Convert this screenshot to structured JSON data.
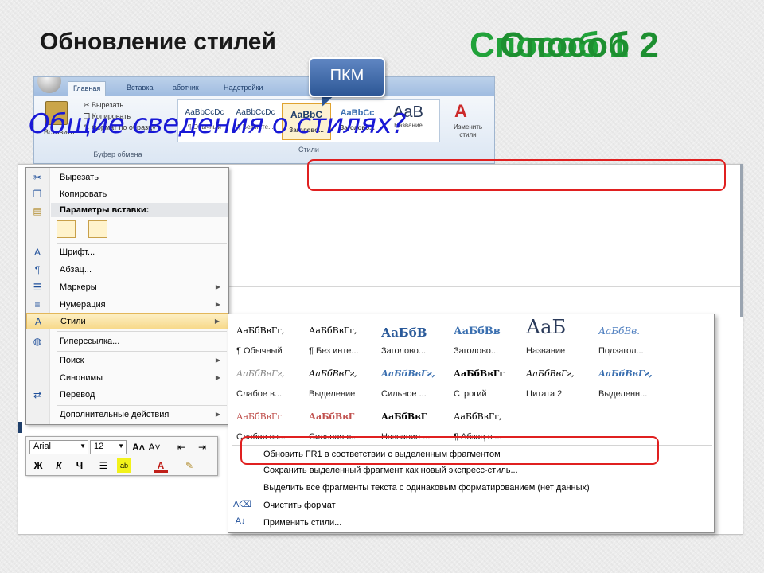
{
  "slide": {
    "title": "Обновление стилей",
    "method_overlay_a": "Способ 1",
    "method_overlay_b": "Способ 2",
    "overview_question": "Общие сведения о стилях?",
    "callout": "ПКМ"
  },
  "ribbon": {
    "tabs": [
      "Главная",
      "Вставка",
      "аботчик",
      "Надстройки"
    ],
    "clipboard": {
      "cut": "Вырезать",
      "copy": "Копировать",
      "format_painter": "Формат по образцу",
      "paste": "Вставить",
      "group_label": "Буфер обмена"
    },
    "style_gallery": [
      {
        "sample": "AaBbCcDc",
        "name": "¶ Обычный"
      },
      {
        "sample": "AaBbCcDc",
        "name": "¶ Без инте..."
      },
      {
        "sample": "AaBbC",
        "name": "Заголово..."
      },
      {
        "sample": "AaBbCc",
        "name": "Заголово..."
      },
      {
        "sample": "AaB",
        "name": "Название"
      }
    ],
    "styles_group_label": "Стили",
    "change_styles": "Изменить стили"
  },
  "context_menu": {
    "items": [
      {
        "icon": "scissors-icon",
        "label": "Вырезать"
      },
      {
        "icon": "copy-icon",
        "label": "Копировать"
      }
    ],
    "paste_header": "Параметры вставки:",
    "items2": [
      {
        "icon": "font-icon",
        "label": "Шрифт...",
        "arrow": false
      },
      {
        "icon": "paragraph-icon",
        "label": "Абзац...",
        "arrow": false
      },
      {
        "icon": "bullets-icon",
        "label": "Маркеры",
        "arrow": true
      },
      {
        "icon": "numbering-icon",
        "label": "Нумерация",
        "arrow": true
      },
      {
        "icon": "styles-icon",
        "label": "Стили",
        "arrow": true
      },
      {
        "icon": "hyperlink-icon",
        "label": "Гиперссылка...",
        "arrow": false
      },
      {
        "icon": "",
        "label": "Поиск",
        "arrow": true
      },
      {
        "icon": "",
        "label": "Синонимы",
        "arrow": true
      },
      {
        "icon": "translate-icon",
        "label": "Перевод",
        "arrow": false
      },
      {
        "icon": "",
        "label": "Дополнительные действия",
        "arrow": true
      }
    ]
  },
  "mini_toolbar": {
    "font": "Arial",
    "size": "12",
    "bold": "Ж",
    "italic": "К",
    "underline": "Ч"
  },
  "styles_flyout": {
    "row1": [
      {
        "sample": "АаБбВвГг,",
        "name": "¶ Обычный",
        "color": "#000000",
        "size": "11px",
        "weight": "normal",
        "style": "normal"
      },
      {
        "sample": "АаБбВвГг,",
        "name": "¶ Без инте...",
        "color": "#000000",
        "size": "11px",
        "weight": "normal",
        "style": "normal"
      },
      {
        "sample": "АаБбВ",
        "name": "Заголово...",
        "color": "#2a5a9a",
        "size": "15px",
        "weight": "bold",
        "style": "normal"
      },
      {
        "sample": "АаБбВв",
        "name": "Заголово...",
        "color": "#3a6fb0",
        "size": "13px",
        "weight": "bold",
        "style": "normal"
      },
      {
        "sample": "АаБ",
        "name": "Название",
        "color": "#2a3a5a",
        "size": "24px",
        "weight": "normal",
        "style": "normal"
      },
      {
        "sample": "АаБбВв.",
        "name": "Подзагол...",
        "color": "#4f7fc0",
        "size": "12px",
        "weight": "normal",
        "style": "italic"
      }
    ],
    "row2": [
      {
        "sample": "АаБбВвГг,",
        "name": "Слабое в...",
        "color": "#888888",
        "size": "11px",
        "weight": "normal",
        "style": "italic"
      },
      {
        "sample": "АаБбВвГг,",
        "name": "Выделение",
        "color": "#000000",
        "size": "11px",
        "weight": "normal",
        "style": "italic"
      },
      {
        "sample": "АаБбВвГг,",
        "name": "Сильное ...",
        "color": "#3a6fb0",
        "size": "11px",
        "weight": "bold",
        "style": "italic"
      },
      {
        "sample": "АаБбВвГг",
        "name": "Строгий",
        "color": "#000000",
        "size": "11px",
        "weight": "bold",
        "style": "normal"
      },
      {
        "sample": "АаБбВвГг,",
        "name": "Цитата 2",
        "color": "#000000",
        "size": "11px",
        "weight": "normal",
        "style": "italic"
      },
      {
        "sample": "АаБбВвГг,",
        "name": "Выделенн...",
        "color": "#3a6fb0",
        "size": "11px",
        "weight": "bold",
        "style": "italic"
      }
    ],
    "row3": [
      {
        "sample": "АаБбВвГг",
        "name": "Слабая сс...",
        "color": "#c0504d",
        "size": "11px",
        "weight": "normal",
        "style": "normal"
      },
      {
        "sample": "АаБбВвГ",
        "name": "Сильная с...",
        "color": "#c0504d",
        "size": "11px",
        "weight": "bold",
        "style": "normal"
      },
      {
        "sample": "АаБбВвГ",
        "name": "Название ...",
        "color": "#000000",
        "size": "11px",
        "weight": "bold",
        "style": "normal"
      },
      {
        "sample": "АаБбВвГг,",
        "name": "¶ Абзац с ...",
        "color": "#000000",
        "size": "11px",
        "weight": "normal",
        "style": "normal"
      }
    ],
    "actions": [
      {
        "icon": "",
        "label": "Обновить FR1 в соответствии с выделенным фрагментом"
      },
      {
        "icon": "",
        "label": "Сохранить выделенный фрагмент как новый экспресс-стиль..."
      },
      {
        "icon": "",
        "label": "Выделить все фрагменты текста с одинаковым форматированием (нет данных)"
      },
      {
        "icon": "clear-format-icon",
        "label": "Очистить формат"
      },
      {
        "icon": "apply-styles-icon",
        "label": "Применить стили..."
      }
    ]
  }
}
